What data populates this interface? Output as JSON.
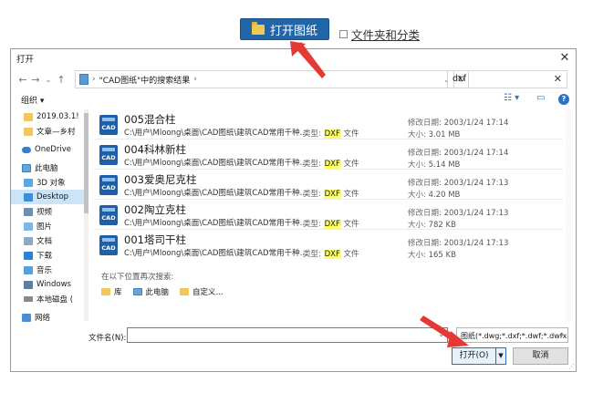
{
  "app": {
    "open_button_label": "打开图纸",
    "folder_category_label": "文件夹和分类"
  },
  "dialog": {
    "title": "打开",
    "close_symbol": "✕",
    "path_text": "\"CAD图纸\"中的搜索结果",
    "path_chevron": "›",
    "search_value": "dxf",
    "organize_label": "组织 ▾",
    "help_symbol": "?",
    "sidebar": {
      "items": [
        {
          "label": "2019.03.1!",
          "icon": "folder-icon",
          "top": false
        },
        {
          "label": "文章—乡村",
          "icon": "folder-icon",
          "top": false
        },
        {
          "label": "OneDrive",
          "icon": "cloud-icon",
          "top": true
        },
        {
          "label": "此电脑",
          "icon": "computer-icon",
          "top": true
        },
        {
          "label": "3D 对象",
          "icon": "3d-objects-icon",
          "top": false
        },
        {
          "label": "Desktop",
          "icon": "desktop-icon",
          "top": false,
          "selected": true
        },
        {
          "label": "视频",
          "icon": "video-icon",
          "top": false
        },
        {
          "label": "图片",
          "icon": "pictures-icon",
          "top": false
        },
        {
          "label": "文档",
          "icon": "documents-icon",
          "top": false
        },
        {
          "label": "下载",
          "icon": "downloads-icon",
          "top": false
        },
        {
          "label": "音乐",
          "icon": "music-icon",
          "top": false
        },
        {
          "label": "Windows",
          "icon": "windows-drive-icon",
          "top": false
        },
        {
          "label": "本地磁盘 (",
          "icon": "local-disk-icon",
          "top": false
        }
      ],
      "network_label": "网络"
    },
    "files": [
      {
        "name": "005混合柱",
        "path": "C:\\用户\\Mloong\\桌面\\CAD图纸\\建筑CAD常用千种...",
        "type_label": "类型:",
        "type_ext": "DXF",
        "type_suffix": "文件",
        "date_label": "修改日期:",
        "date": "2003/1/24 17:14",
        "size_label": "大小:",
        "size": "3.01 MB"
      },
      {
        "name": "004科林新柱",
        "path": "C:\\用户\\Mloong\\桌面\\CAD图纸\\建筑CAD常用千种...",
        "type_label": "类型:",
        "type_ext": "DXF",
        "type_suffix": "文件",
        "date_label": "修改日期:",
        "date": "2003/1/24 17:14",
        "size_label": "大小:",
        "size": "5.14 MB"
      },
      {
        "name": "003爱奥尼克柱",
        "path": "C:\\用户\\Mloong\\桌面\\CAD图纸\\建筑CAD常用千种...",
        "type_label": "类型:",
        "type_ext": "DXF",
        "type_suffix": "文件",
        "date_label": "修改日期:",
        "date": "2003/1/24 17:13",
        "size_label": "大小:",
        "size": "4.20 MB"
      },
      {
        "name": "002陶立克柱",
        "path": "C:\\用户\\Mloong\\桌面\\CAD图纸\\建筑CAD常用千种...",
        "type_label": "类型:",
        "type_ext": "DXF",
        "type_suffix": "文件",
        "date_label": "修改日期:",
        "date": "2003/1/24 17:13",
        "size_label": "大小:",
        "size": "782 KB"
      },
      {
        "name": "001塔司干柱",
        "path": "C:\\用户\\Mloong\\桌面\\CAD图纸\\建筑CAD常用千种...",
        "type_label": "类型:",
        "type_ext": "DXF",
        "type_suffix": "文件",
        "date_label": "修改日期:",
        "date": "2003/1/24 17:13",
        "size_label": "大小:",
        "size": "165 KB"
      }
    ],
    "cad_icon_text": "CAD",
    "search_again": {
      "label": "在以下位置再次搜索:",
      "locations": [
        {
          "label": "库",
          "icon": "library-icon"
        },
        {
          "label": "此电脑",
          "icon": "computer-icon"
        },
        {
          "label": "自定义...",
          "icon": "custom-folder-icon"
        }
      ]
    },
    "filename_label": "文件名(N):",
    "filename_value": "",
    "filetype_value": "图纸(*.dwg;*.dxf;*.dwf;*.dwfx)",
    "open_label": "打开(O)",
    "cancel_label": "取消"
  }
}
